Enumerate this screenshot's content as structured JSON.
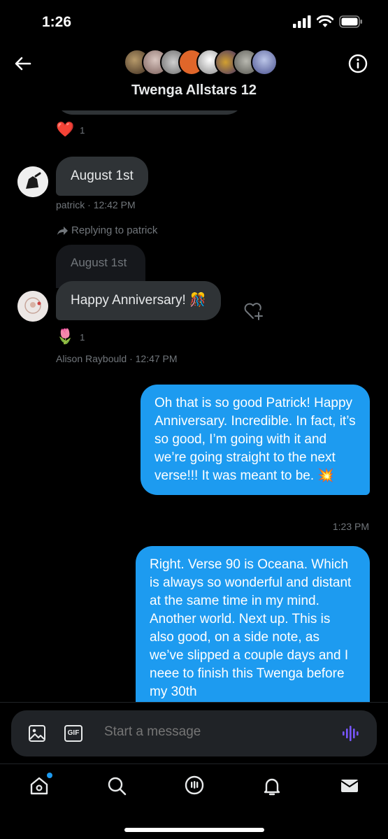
{
  "status_bar": {
    "time": "1:26"
  },
  "header": {
    "title": "Twenga Allstars 12"
  },
  "messages": {
    "m1": {
      "reaction_emoji": "❤️",
      "reaction_count": "1"
    },
    "m2": {
      "text": "August 1st",
      "sender": "patrick",
      "time": "12:42 PM"
    },
    "m3": {
      "reply_label": "Replying to patrick",
      "quoted_text": "August 1st",
      "text": "Happy Anniversary! 🎊",
      "reaction_emoji": "🌷",
      "reaction_count": "1",
      "sender": "Alison Raybould",
      "time": "12:47 PM"
    },
    "m4": {
      "text": "Oh that is so good Patrick! Happy Anniversary. Incredible. In fact, it’s so good, I’m going with it and we’re going straight to the next verse!!! It was meant to be. 💥",
      "time": "1:23 PM"
    },
    "m5": {
      "text": "Right. Verse 90 is Oceana. Which is always so wonderful and distant at the same time in my mind. Another world. Next up. This is also good, on a side note, as we’ve slipped a couple days and I neee to finish this Twenga before my 30th"
    }
  },
  "composer": {
    "placeholder": "Start a message",
    "gif_label": "GIF"
  },
  "colors": {
    "accent": "#1d9bf0",
    "incoming": "#2f3336",
    "voice": "#7856ff"
  }
}
